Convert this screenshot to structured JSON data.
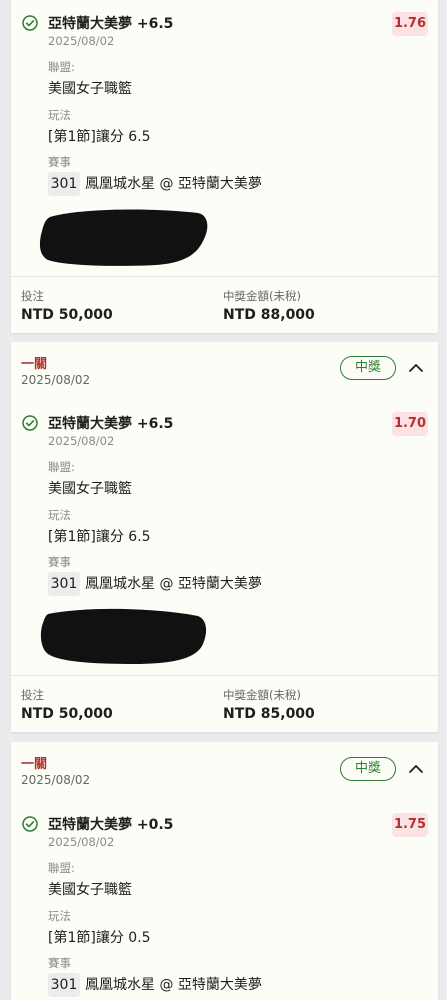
{
  "cards": [
    {
      "header": null,
      "selection": {
        "title": "亞特蘭大美夢 +6.5",
        "date": "2025/08/02",
        "odds": "1.76",
        "league_label": "聯盟:",
        "league": "美國女子職籃",
        "play_label": "玩法",
        "play": "[第1節]讓分 6.5",
        "event_label": "賽事",
        "event_id": "301",
        "event_name": "鳳凰城水星 @ 亞特蘭大美夢"
      },
      "footer": {
        "stake_label": "投注",
        "stake": "NTD 50,000",
        "payout_label": "中獎金額(未稅)",
        "payout": "NTD 88,000"
      }
    },
    {
      "header": {
        "type": "一關",
        "date": "2025/08/02",
        "badge": "中獎"
      },
      "selection": {
        "title": "亞特蘭大美夢 +6.5",
        "date": "2025/08/02",
        "odds": "1.70",
        "league_label": "聯盟:",
        "league": "美國女子職籃",
        "play_label": "玩法",
        "play": "[第1節]讓分 6.5",
        "event_label": "賽事",
        "event_id": "301",
        "event_name": "鳳凰城水星 @ 亞特蘭大美夢"
      },
      "footer": {
        "stake_label": "投注",
        "stake": "NTD 50,000",
        "payout_label": "中獎金額(未稅)",
        "payout": "NTD 85,000"
      }
    },
    {
      "header": {
        "type": "一關",
        "date": "2025/08/02",
        "badge": "中獎"
      },
      "selection": {
        "title": "亞特蘭大美夢 +0.5",
        "date": "2025/08/02",
        "odds": "1.75",
        "league_label": "聯盟:",
        "league": "美國女子職籃",
        "play_label": "玩法",
        "play": "[第1節]讓分 0.5",
        "event_label": "賽事",
        "event_id": "301",
        "event_name": "鳳凰城水星 @ 亞特蘭大美夢"
      }
    }
  ],
  "icons": {
    "status": "check-circle-icon",
    "toggle": "chevron-up-icon"
  },
  "colors": {
    "win_green": "#2e7d32",
    "odds_red": "#b53030",
    "odds_bg": "#fbe3e3"
  }
}
